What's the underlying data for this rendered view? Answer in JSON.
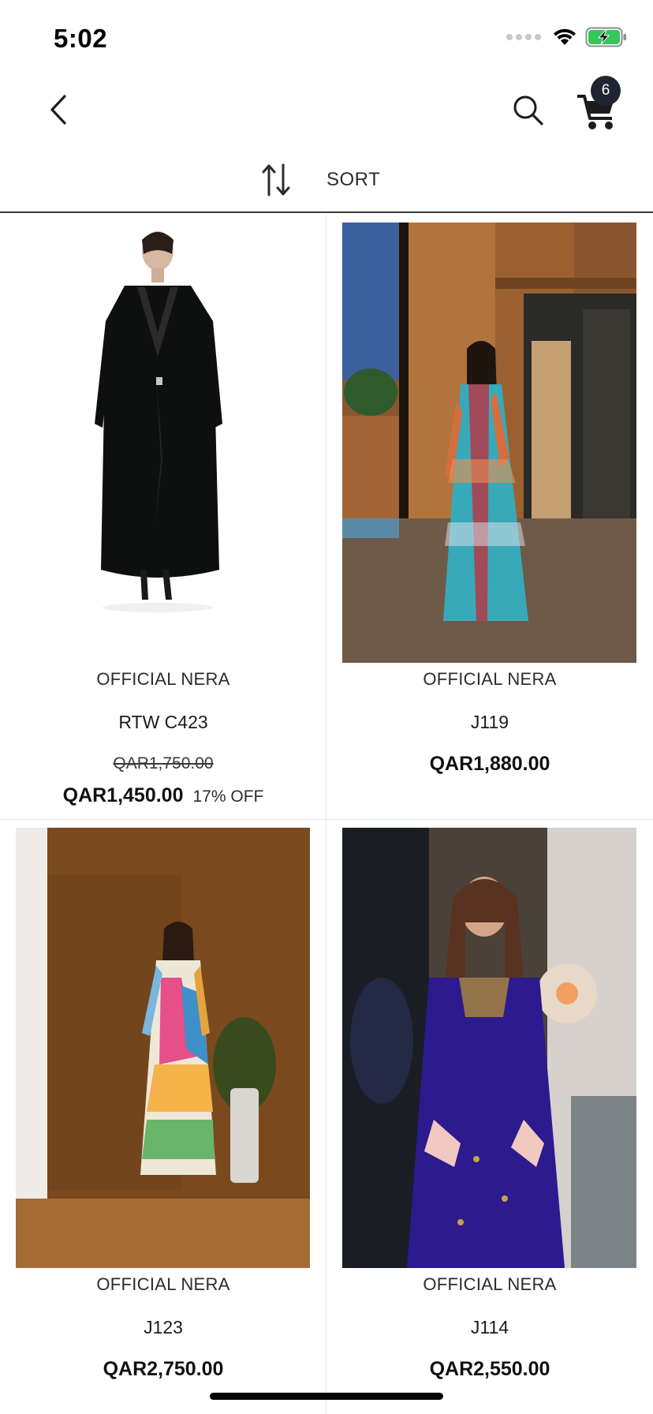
{
  "status_bar": {
    "time": "5:02",
    "icons": [
      "signal-icon",
      "wifi-icon",
      "battery-charging-icon"
    ],
    "battery_color": "#34c759"
  },
  "nav": {
    "back_icon": "chevron-left-icon",
    "search_icon": "search-icon",
    "cart_icon": "cart-icon",
    "cart_count": "6"
  },
  "sort": {
    "icon": "sort-arrows-icon",
    "label": "SORT"
  },
  "products": [
    {
      "brand": "OFFICIAL NERA",
      "name": "RTW C423",
      "old_price": "QAR1,750.00",
      "price": "QAR1,450.00",
      "discount": "17% OFF",
      "image": "black-abaya-photo"
    },
    {
      "brand": "OFFICIAL NERA",
      "name": "J119",
      "price": "QAR1,880.00",
      "image": "zigzag-kaftan-photo"
    },
    {
      "brand": "OFFICIAL NERA",
      "name": "J123",
      "price": "QAR2,750.00",
      "image": "printed-dress-photo"
    },
    {
      "brand": "OFFICIAL NERA",
      "name": "J114",
      "price": "QAR2,550.00",
      "image": "velvet-jalabiya-photo"
    }
  ]
}
